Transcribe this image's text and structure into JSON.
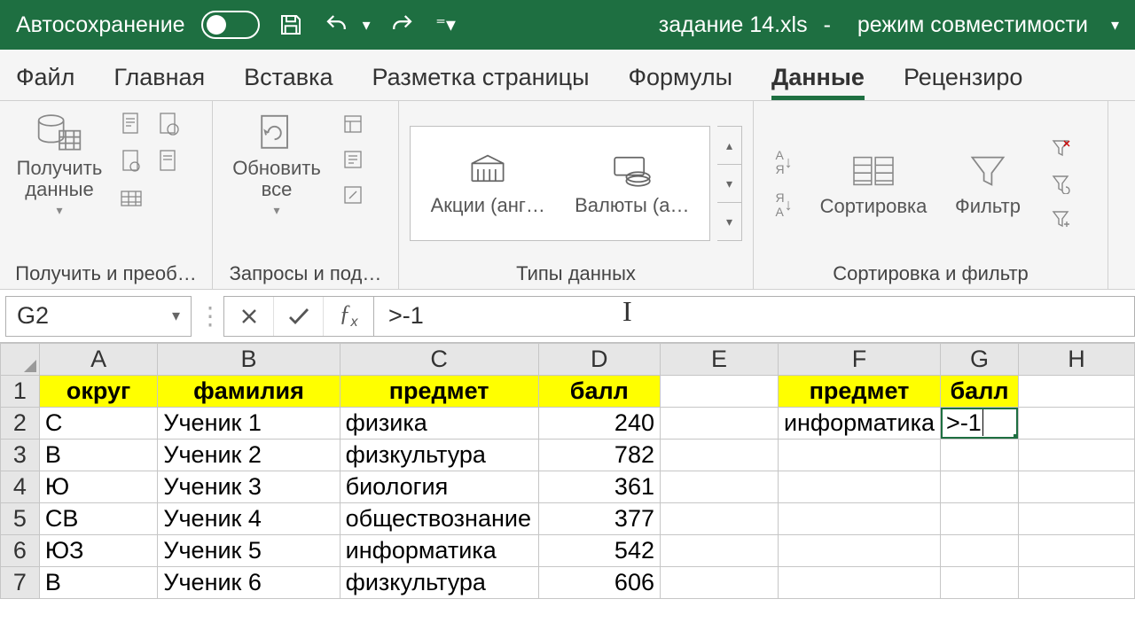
{
  "titlebar": {
    "autosave": "Автосохранение",
    "filename": "задание 14.xls",
    "mode": "режим совместимости"
  },
  "tabs": {
    "file": "Файл",
    "home": "Главная",
    "insert": "Вставка",
    "layout": "Разметка страницы",
    "formulas": "Формулы",
    "data": "Данные",
    "review": "Рецензиро"
  },
  "ribbon": {
    "get_data": "Получить данные",
    "group_get": "Получить и преоб…",
    "refresh": "Обновить все",
    "group_queries": "Запросы и под…",
    "stocks": "Акции (анг…",
    "currency": "Валюты (а…",
    "group_types": "Типы данных",
    "sort": "Сортировка",
    "filter": "Фильтр",
    "group_sortfilter": "Сортировка и фильтр"
  },
  "formula_bar": {
    "name_box": "G2",
    "formula": ">-1"
  },
  "columns": [
    "A",
    "B",
    "C",
    "D",
    "E",
    "F",
    "G",
    "H"
  ],
  "header_row": {
    "A": "округ",
    "B": "фамилия",
    "C": "предмет",
    "D": "балл",
    "F": "предмет",
    "G": "балл"
  },
  "data_rows": [
    {
      "r": "2",
      "A": "С",
      "B": "Ученик 1",
      "C": "физика",
      "D": "240",
      "F": "информатика",
      "G": ">-1"
    },
    {
      "r": "3",
      "A": "В",
      "B": "Ученик 2",
      "C": "физкультура",
      "D": "782",
      "F": "",
      "G": ""
    },
    {
      "r": "4",
      "A": "Ю",
      "B": "Ученик 3",
      "C": "биология",
      "D": "361",
      "F": "",
      "G": ""
    },
    {
      "r": "5",
      "A": "СВ",
      "B": "Ученик 4",
      "C": "обществознание",
      "D": "377",
      "F": "",
      "G": ""
    },
    {
      "r": "6",
      "A": "ЮЗ",
      "B": "Ученик 5",
      "C": "информатика",
      "D": "542",
      "F": "",
      "G": ""
    },
    {
      "r": "7",
      "A": "В",
      "B": "Ученик 6",
      "C": "физкультура",
      "D": "606",
      "F": "",
      "G": ""
    }
  ]
}
